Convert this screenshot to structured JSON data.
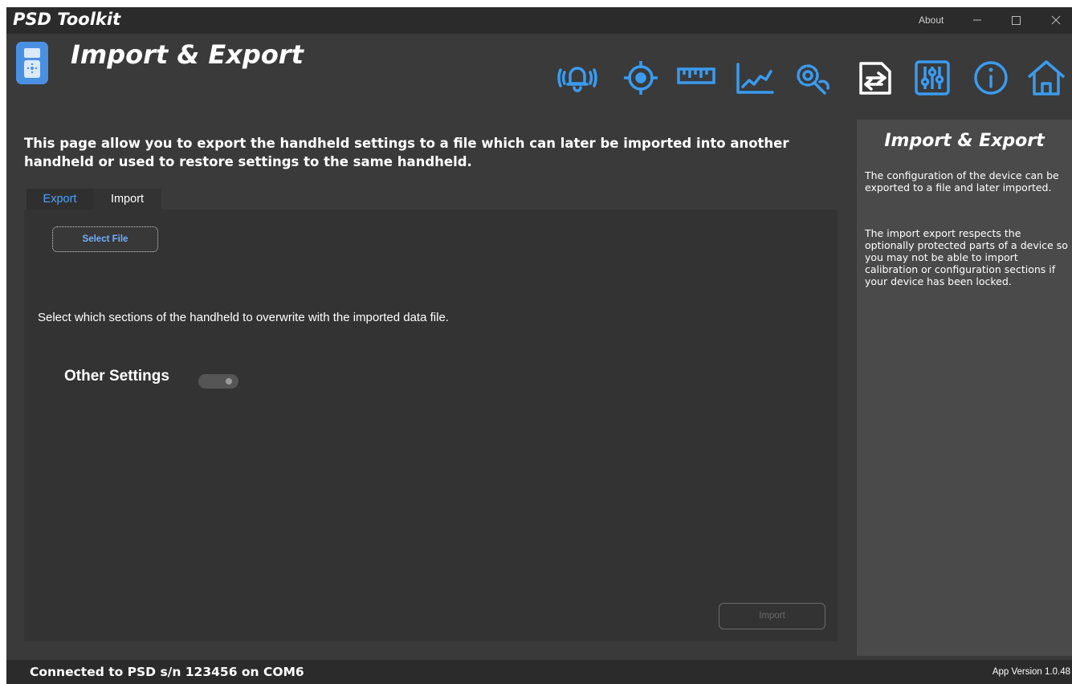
{
  "app": {
    "title": "PSD Toolkit",
    "about_label": "About"
  },
  "header": {
    "title": "Import & Export",
    "page_icon": "handheld-device-icon"
  },
  "nav": {
    "icons": [
      "alarm-bell-icon",
      "target-crosshair-icon",
      "ruler-icon",
      "line-chart-icon",
      "settings-wrench-icon",
      "import-export-icon",
      "sliders-icon",
      "info-icon",
      "home-icon"
    ],
    "active": "import-export-icon",
    "accent_color": "#3a9bf0"
  },
  "main": {
    "intro": "This page allow you to export the handheld settings to a file which can later be imported into another handheld or used to restore settings to the same handheld.",
    "tabs": [
      {
        "label": "Export"
      },
      {
        "label": "Import"
      }
    ],
    "active_tab": "Import",
    "select_file_label": "Select File",
    "sections_text": "Select which sections of the handheld to overwrite with the imported data file.",
    "other_settings_label": "Other Settings",
    "other_settings_enabled": false,
    "import_button_label": "Import"
  },
  "help": {
    "title": "Import & Export",
    "paragraph1": "The configuration of the device can be exported to a file and later imported.",
    "paragraph2": "The import export respects the optionally protected parts of a device so you may not be able to import calibration or configuration sections if your device has been locked."
  },
  "status": {
    "connection": "Connected to PSD s/n 123456 on COM6",
    "version": "App Version 1.0.48"
  }
}
